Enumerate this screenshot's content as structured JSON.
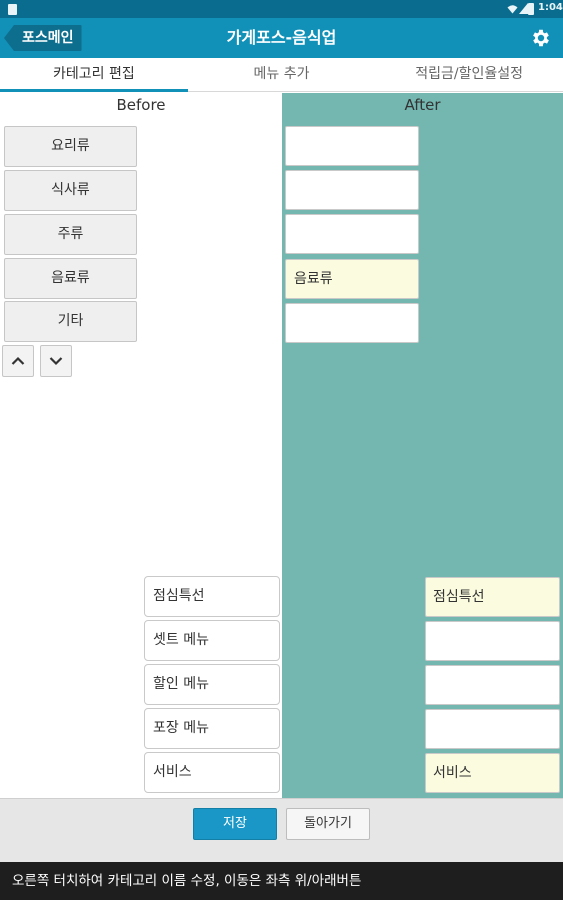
{
  "status_bar": {
    "time": "1:04"
  },
  "header": {
    "back_label": "포스메인",
    "title": "가게포스-음식업",
    "settings_icon": "gear-icon"
  },
  "tabs": [
    {
      "label": "카테고리 편집",
      "active": true
    },
    {
      "label": "메뉴 추가",
      "active": false
    },
    {
      "label": "적립금/할인율설정",
      "active": false
    }
  ],
  "before": {
    "title": "Before",
    "categories": [
      "요리류",
      "식사류",
      "주류",
      "음료류",
      "기타"
    ],
    "specials": [
      "점심특선",
      "셋트 메뉴",
      "할인 메뉴",
      "포장 메뉴",
      "서비스"
    ]
  },
  "after": {
    "title": "After",
    "categories": [
      "",
      "",
      "",
      "음료류",
      ""
    ],
    "specials": [
      "점심특선",
      "",
      "",
      "",
      "서비스"
    ]
  },
  "actions": {
    "save_label": "저장",
    "back_label": "돌아가기"
  },
  "help_text": "오른쪽 터치하여 카테고리 이름 수정, 이동은 좌측 위/아래버튼",
  "colors": {
    "header": "#1190b8",
    "after_panel": "#74b6b0",
    "filled_slot": "#fbfbe0",
    "save_button": "#1a97c6"
  }
}
